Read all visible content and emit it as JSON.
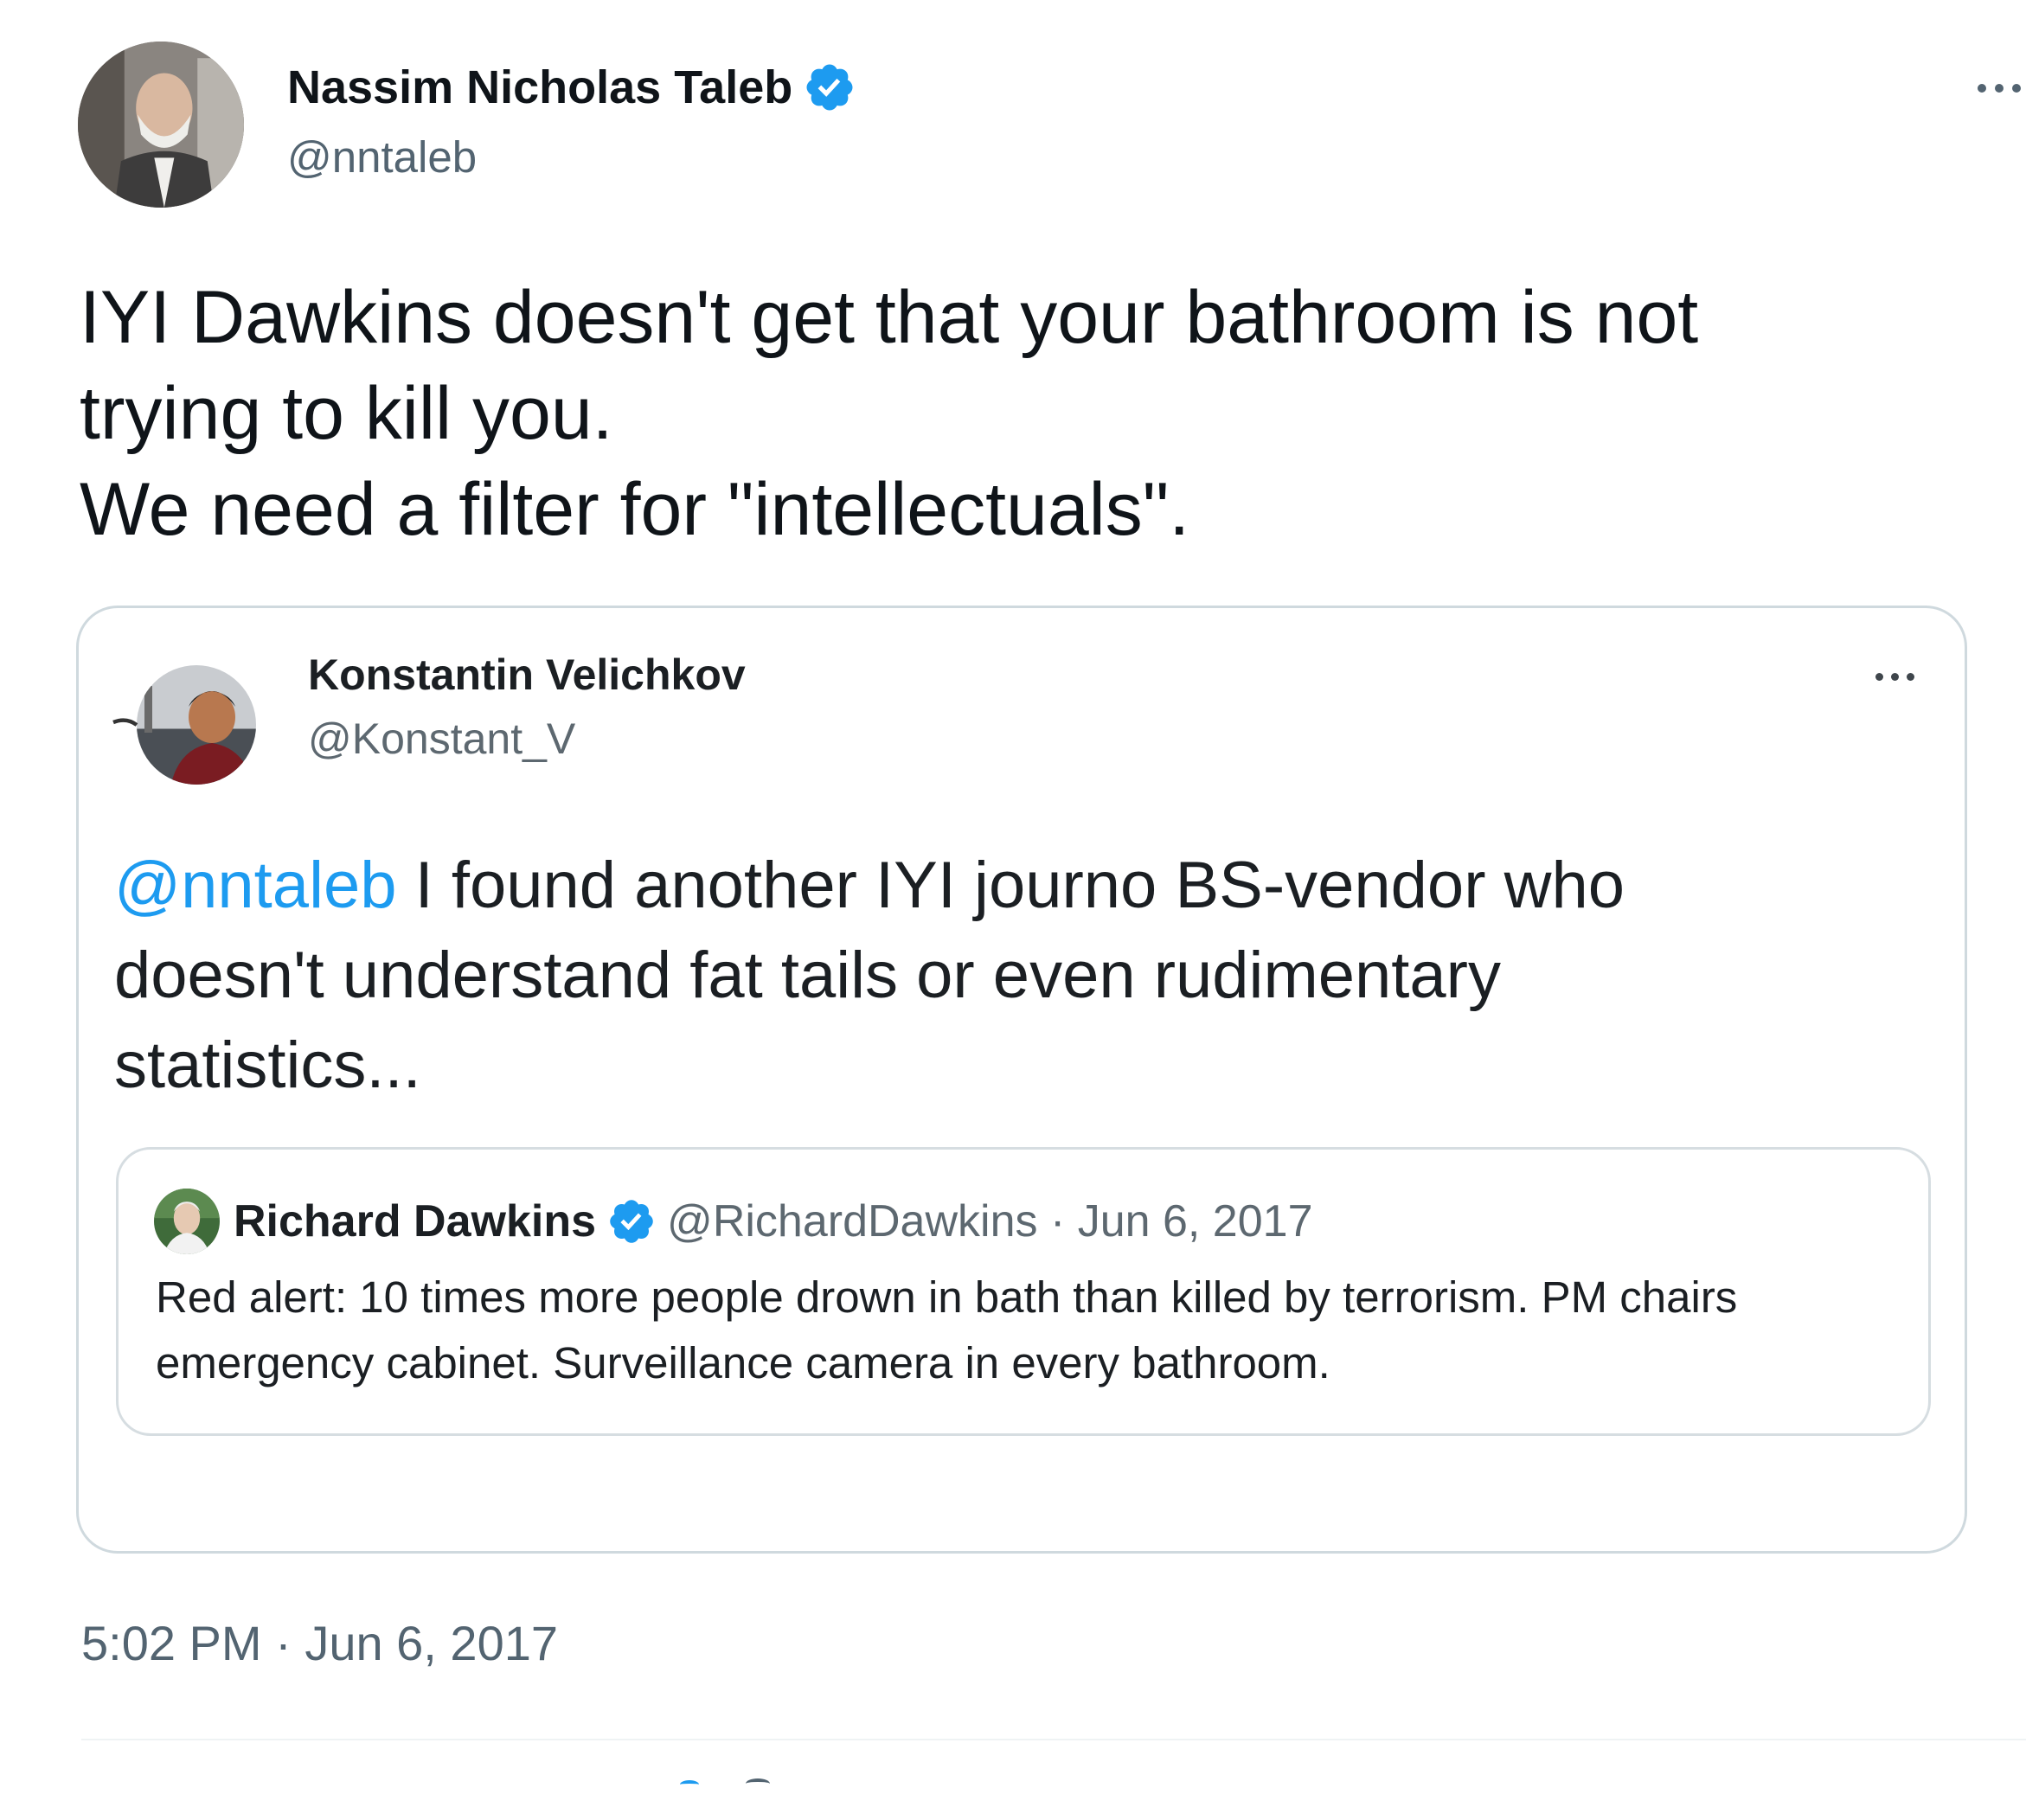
{
  "tweet": {
    "author": {
      "name": "Nassim Nicholas Taleb",
      "handle": "@nntaleb",
      "verified": true
    },
    "text_lines": [
      "IYI Dawkins doesn't get that your bathroom is not",
      "trying to kill you.",
      "We need a filter for \"intellectuals\"."
    ],
    "timestamp": "5:02 PM · Jun 6, 2017"
  },
  "quoted_tweet": {
    "author": {
      "name": "Konstantin Velichkov",
      "handle": "@Konstant_V"
    },
    "mention": "@nntaleb",
    "text_lines": [
      " I found another IYI journo BS-vendor who",
      "doesn't understand fat tails or even rudimentary",
      "statistics..."
    ]
  },
  "nested_quoted_tweet": {
    "author": {
      "name": "Richard Dawkins",
      "handle": "@RichardDawkins",
      "verified": true
    },
    "meta": "@RichardDawkins · Jun 6, 2017",
    "text_lines": [
      "Red alert: 10 times more people drown in bath than killed by terrorism. PM chairs",
      "emergency cabinet. Surveillance camera in every bathroom."
    ]
  },
  "icons": {
    "more": "more-horizontal-icon",
    "verified": "verified-badge-icon"
  },
  "colors": {
    "link": "#1d9bf0",
    "secondary_text": "#536471",
    "primary_text": "#0f1419",
    "border": "#cfd9de"
  }
}
